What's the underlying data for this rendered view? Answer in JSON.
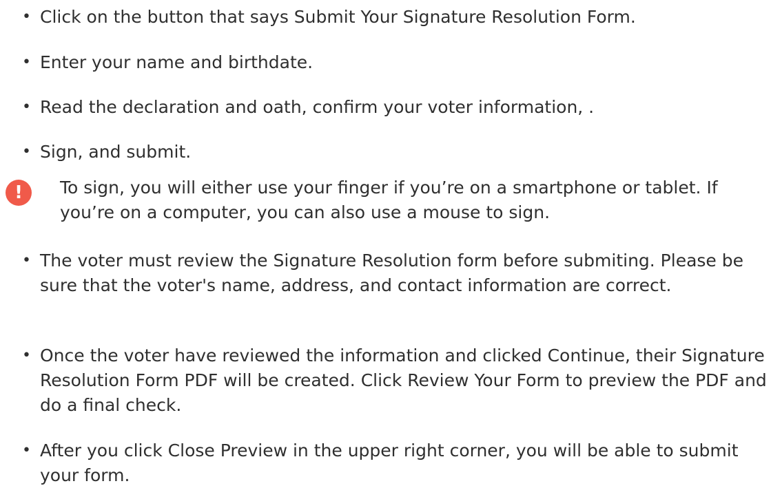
{
  "steps": [
    {
      "text": "Click on the button that says Submit Your Signature Resolution Form."
    },
    {
      "text": "Enter your name and birthdate."
    },
    {
      "text": "Read the declaration and oath, confirm your voter information, ."
    },
    {
      "text": "Sign, and submit."
    }
  ],
  "note": {
    "icon": "exclamation-icon",
    "icon_glyph": "!",
    "icon_color": "#f05a4a",
    "text": "To sign, you will either use your finger if you’re on a smartphone or tablet. If you’re on a computer, you can also use a mouse to sign."
  },
  "more_steps": [
    {
      "text": "The voter must review the Signature Resolution form before submiting. Please be sure that the voter's name, address, and contact information are correct."
    },
    {
      "text": "Once the voter have reviewed the information and clicked Continue, their Signature Resolution Form PDF will be created. Click Review Your Form to preview the PDF and do a final check."
    },
    {
      "text": "After you click Close Preview in the upper right corner, you will be able to submit your form."
    }
  ],
  "bullet_glyph": "•"
}
